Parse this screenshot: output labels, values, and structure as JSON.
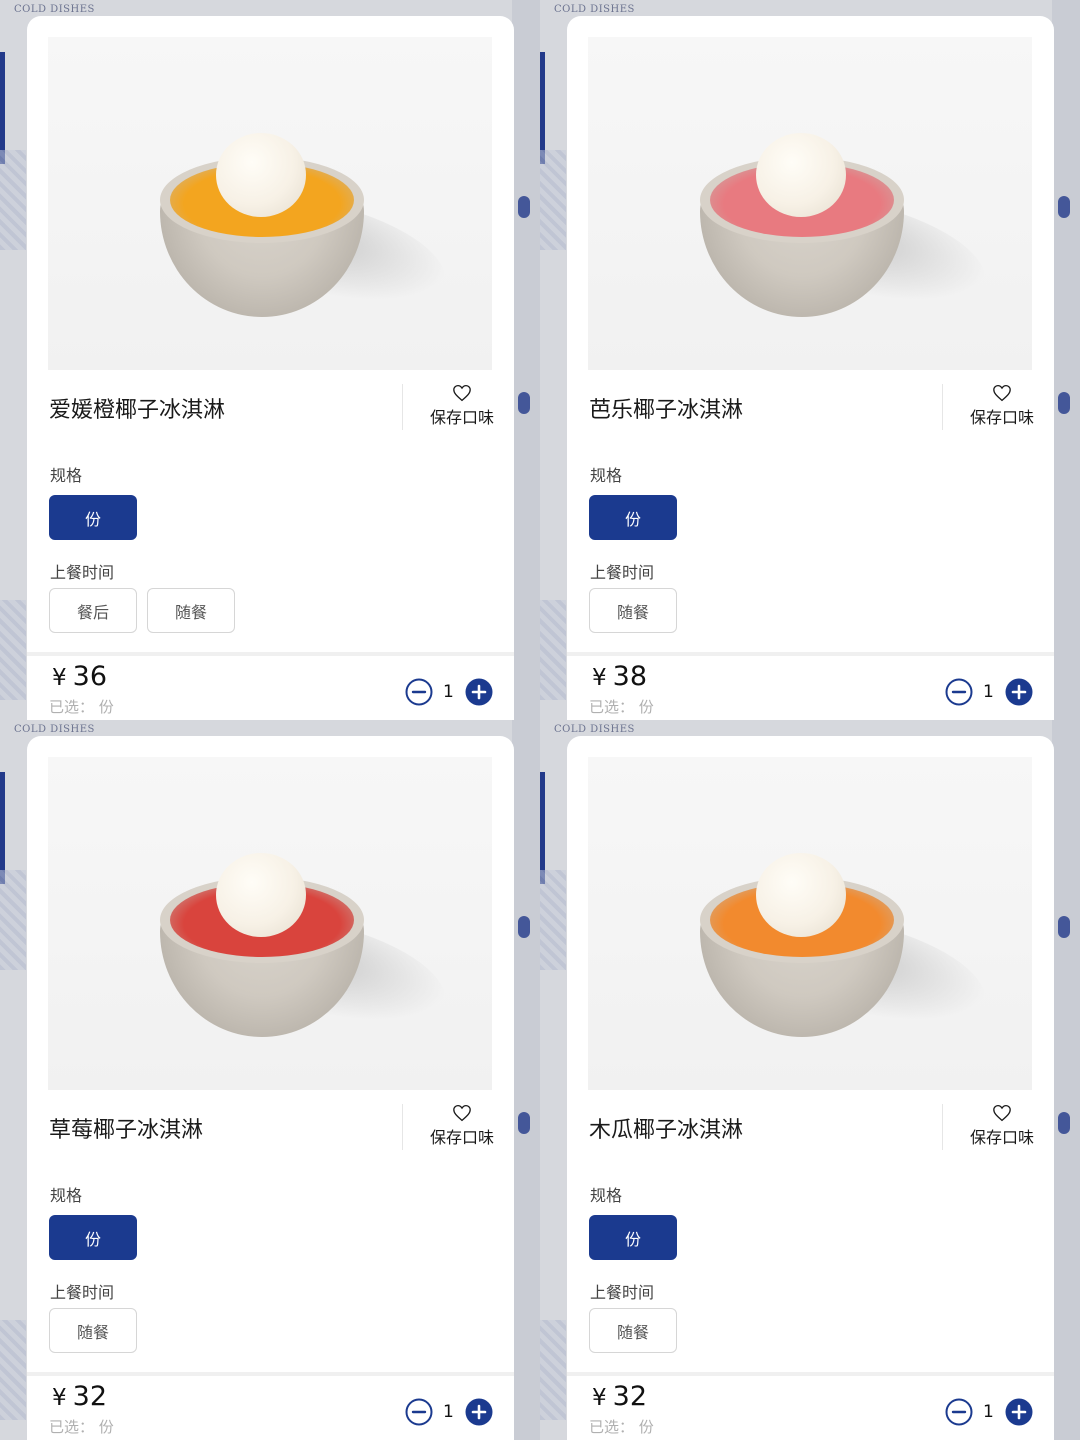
{
  "background": {
    "header": "COLD DISHES",
    "accent_color": "#1b3a8f"
  },
  "labels": {
    "favorite": "保存口味",
    "spec_section": "规格",
    "time_section": "上餐时间",
    "chosen_prefix": "已选：",
    "currency": "¥"
  },
  "cards": [
    {
      "name": "爱媛橙椰子冰淇淋",
      "fruit_color": "#f3a51f",
      "spec_options": [
        {
          "label": "份",
          "selected": true
        }
      ],
      "time_options": [
        {
          "label": "餐后",
          "selected": false
        },
        {
          "label": "随餐",
          "selected": false
        }
      ],
      "price": "36",
      "chosen": "份",
      "quantity": "1"
    },
    {
      "name": "芭乐椰子冰淇淋",
      "fruit_color": "#e87a80",
      "spec_options": [
        {
          "label": "份",
          "selected": true
        }
      ],
      "time_options": [
        {
          "label": "随餐",
          "selected": false
        }
      ],
      "price": "38",
      "chosen": "份",
      "quantity": "1"
    },
    {
      "name": "草莓椰子冰淇淋",
      "fruit_color": "#d9443d",
      "spec_options": [
        {
          "label": "份",
          "selected": true
        }
      ],
      "time_options": [
        {
          "label": "随餐",
          "selected": false
        }
      ],
      "price": "32",
      "chosen": "份",
      "quantity": "1"
    },
    {
      "name": "木瓜椰子冰淇淋",
      "fruit_color": "#f28a2e",
      "spec_options": [
        {
          "label": "份",
          "selected": true
        }
      ],
      "time_options": [
        {
          "label": "随餐",
          "selected": false
        }
      ],
      "price": "32",
      "chosen": "份",
      "quantity": "1"
    }
  ]
}
